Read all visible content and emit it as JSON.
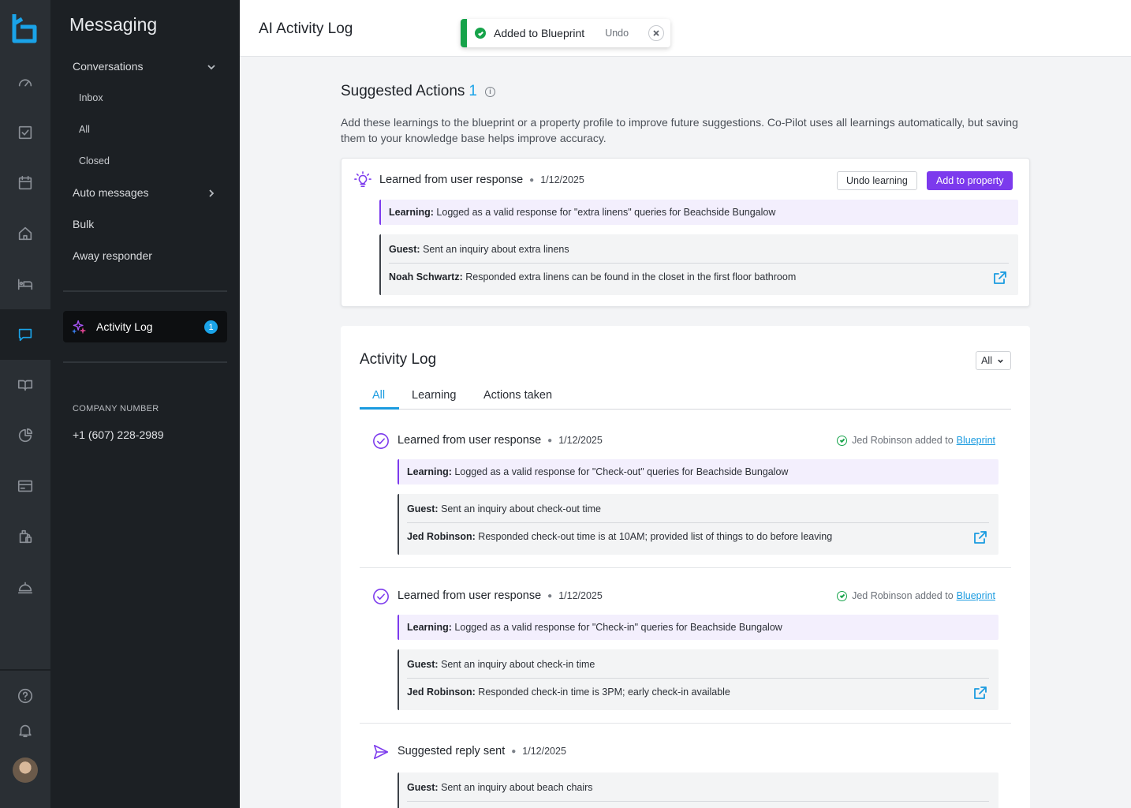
{
  "app": {
    "section_title": "Messaging",
    "page_title": "AI Activity Log"
  },
  "toast": {
    "message": "Added to Blueprint",
    "undo_label": "Undo"
  },
  "subnav": {
    "conversations": "Conversations",
    "inbox": "Inbox",
    "all": "All",
    "closed": "Closed",
    "auto_messages": "Auto messages",
    "bulk": "Bulk",
    "away_responder": "Away responder",
    "activity_log": "Activity Log",
    "activity_log_badge": "1",
    "company_number_label": "COMPANY NUMBER",
    "company_number": "+1 (607) 228-2989"
  },
  "rail_icons": [
    "logo-icon",
    "dashboard-icon",
    "tasks-icon",
    "calendar-icon",
    "home-icon",
    "bed-icon",
    "messaging-icon",
    "guidebook-icon",
    "reports-icon",
    "payments-icon",
    "luggage-icon",
    "concierge-icon",
    "help-icon",
    "bell-icon",
    "avatar"
  ],
  "suggested": {
    "title": "Suggested Actions",
    "count": "1",
    "description": "Add these learnings to the blueprint or a property profile to improve future suggestions. Co-Pilot uses all learnings automatically, but saving them to your knowledge base helps improve accuracy.",
    "card": {
      "heading": "Learned from user response",
      "date": "1/12/2025",
      "undo_button": "Undo learning",
      "add_button": "Add to property",
      "learning_label": "Learning:",
      "learning_text": " Logged as a valid response for \"extra linens\" queries for Beachside Bungalow",
      "guest_label": "Guest:",
      "guest_text": " Sent an inquiry about extra linens",
      "host_label": "Noah Schwartz:",
      "host_text": " Responded extra linens can be found in the closet in the first floor bathroom"
    }
  },
  "activity_log": {
    "title": "Activity Log",
    "filter_value": "All",
    "tabs": [
      "All",
      "Learning",
      "Actions taken"
    ],
    "entries": [
      {
        "heading": "Learned from user response",
        "date": "1/12/2025",
        "added_text": "Jed Robinson added to",
        "added_link": "Blueprint",
        "learning_label": "Learning:",
        "learning_text": " Logged as a valid response for \"Check-out\" queries for Beachside Bungalow",
        "guest_label": "Guest:",
        "guest_text": " Sent an inquiry about check-out time",
        "host_label": "Jed Robinson:",
        "host_text": " Responded check-out time is at 10AM; provided list of things to do before leaving"
      },
      {
        "heading": "Learned from user response",
        "date": "1/12/2025",
        "added_text": "Jed Robinson added to",
        "added_link": "Blueprint",
        "learning_label": "Learning:",
        "learning_text": " Logged as a valid response for \"Check-in\" queries for Beachside Bungalow",
        "guest_label": "Guest:",
        "guest_text": " Sent an inquiry about check-in time",
        "host_label": "Jed Robinson:",
        "host_text": " Responded check-in time is 3PM; early check-in available"
      },
      {
        "heading": "Suggested reply sent",
        "date": "1/12/2025",
        "guest_label": "Guest:",
        "guest_text": " Sent an inquiry about beach chairs"
      }
    ]
  },
  "colors": {
    "accent_blue": "#1aa3e8",
    "accent_purple": "#7c3aed",
    "success_green": "#16a34a",
    "rail_bg": "#2a2f34",
    "subnav_bg": "#1c2024"
  }
}
